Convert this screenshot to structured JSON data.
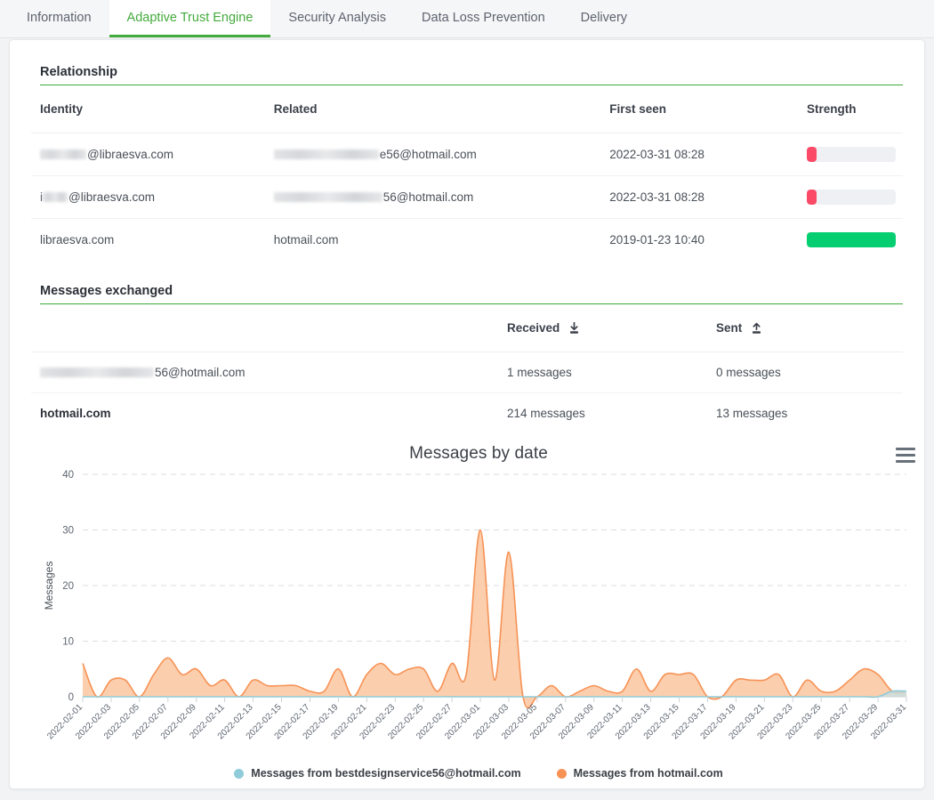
{
  "tabs": [
    {
      "label": "Information",
      "active": false
    },
    {
      "label": "Adaptive Trust Engine",
      "active": true
    },
    {
      "label": "Security Analysis",
      "active": false
    },
    {
      "label": "Data Loss Prevention",
      "active": false
    },
    {
      "label": "Delivery",
      "active": false
    }
  ],
  "relationship": {
    "title": "Relationship",
    "headers": [
      "Identity",
      "Related",
      "First seen",
      "Strength"
    ],
    "rows": [
      {
        "identity_masked_width": 52,
        "identity_suffix": "@libraesva.com",
        "related_masked_width": 118,
        "related_suffix": "e56@hotmail.com",
        "first_seen": "2022-03-31 08:28",
        "strength_percent": 11,
        "strength_color": "#fa4a68"
      },
      {
        "identity_masked_prefix": "i",
        "identity_masked_width": 28,
        "identity_suffix": "@libraesva.com",
        "related_masked_width": 122,
        "related_suffix": "56@hotmail.com",
        "first_seen": "2022-03-31 08:28",
        "strength_percent": 11,
        "strength_color": "#fa4a68"
      },
      {
        "identity_plain": "libraesva.com",
        "related_plain": "hotmail.com",
        "first_seen": "2019-01-23 10:40",
        "strength_percent": 100,
        "strength_color": "#05ce71"
      }
    ]
  },
  "messages_exchanged": {
    "title": "Messages exchanged",
    "headers": [
      "",
      "Received",
      "Sent"
    ],
    "received_icon": "download-icon",
    "sent_icon": "upload-icon",
    "rows": [
      {
        "address_masked_width": 128,
        "address_suffix": "56@hotmail.com",
        "received": "1 messages",
        "sent": "0 messages"
      },
      {
        "address_plain": "hotmail.com",
        "received": "214 messages",
        "sent": "13 messages"
      }
    ]
  },
  "chart_menu_icon": "hamburger-menu-icon",
  "chart_data": {
    "type": "area",
    "title": "Messages by date",
    "xlabel": "",
    "ylabel": "Messages",
    "ylim": [
      0,
      40
    ],
    "yticks": [
      0,
      10,
      20,
      30,
      40
    ],
    "grid": true,
    "legend_position": "bottom",
    "x": [
      "2022-02-01",
      "2022-02-02",
      "2022-02-03",
      "2022-02-04",
      "2022-02-05",
      "2022-02-06",
      "2022-02-07",
      "2022-02-08",
      "2022-02-09",
      "2022-02-10",
      "2022-02-11",
      "2022-02-12",
      "2022-02-13",
      "2022-02-14",
      "2022-02-15",
      "2022-02-16",
      "2022-02-17",
      "2022-02-18",
      "2022-02-19",
      "2022-02-20",
      "2022-02-21",
      "2022-02-22",
      "2022-02-23",
      "2022-02-24",
      "2022-02-25",
      "2022-02-26",
      "2022-02-27",
      "2022-02-28",
      "2022-03-01",
      "2022-03-02",
      "2022-03-03",
      "2022-03-04",
      "2022-03-05",
      "2022-03-06",
      "2022-03-07",
      "2022-03-08",
      "2022-03-09",
      "2022-03-10",
      "2022-03-11",
      "2022-03-12",
      "2022-03-13",
      "2022-03-14",
      "2022-03-15",
      "2022-03-16",
      "2022-03-17",
      "2022-03-18",
      "2022-03-19",
      "2022-03-20",
      "2022-03-21",
      "2022-03-22",
      "2022-03-23",
      "2022-03-24",
      "2022-03-25",
      "2022-03-26",
      "2022-03-27",
      "2022-03-28",
      "2022-03-29",
      "2022-03-30",
      "2022-03-31"
    ],
    "xtick_labels": [
      "2022-02-01",
      "2022-02-03",
      "2022-02-05",
      "2022-02-07",
      "2022-02-09",
      "2022-02-11",
      "2022-02-13",
      "2022-02-15",
      "2022-02-17",
      "2022-02-19",
      "2022-02-21",
      "2022-02-23",
      "2022-02-25",
      "2022-02-27",
      "2022-03-01",
      "2022-03-03",
      "2022-03-05",
      "2022-03-07",
      "2022-03-09",
      "2022-03-11",
      "2022-03-13",
      "2022-03-15",
      "2022-03-17",
      "2022-03-19",
      "2022-03-21",
      "2022-03-23",
      "2022-03-25",
      "2022-03-27",
      "2022-03-29",
      "2022-03-31"
    ],
    "series": [
      {
        "name": "Messages from bestdesignservice56@hotmail.com",
        "color": "#8fcbd9",
        "fill": "#c3dfe6",
        "values": [
          0,
          0,
          0,
          0,
          0,
          0,
          0,
          0,
          0,
          0,
          0,
          0,
          0,
          0,
          0,
          0,
          0,
          0,
          0,
          0,
          0,
          0,
          0,
          0,
          0,
          0,
          0,
          0,
          0,
          0,
          0,
          0,
          0,
          0,
          0,
          0,
          0,
          0,
          0,
          0,
          0,
          0,
          0,
          0,
          0,
          0,
          0,
          0,
          0,
          0,
          0,
          0,
          0,
          0,
          0,
          0,
          0,
          1,
          1
        ]
      },
      {
        "name": "Messages from hotmail.com",
        "color": "#f79255",
        "fill": "#fac69f",
        "values": [
          6,
          0,
          3,
          3,
          0,
          4,
          7,
          4,
          5,
          2,
          3,
          0,
          3,
          2,
          2,
          2,
          1,
          1,
          5,
          0,
          4,
          6,
          4,
          5,
          5,
          1,
          6,
          4,
          30,
          3,
          26,
          0,
          0,
          2,
          0,
          1,
          2,
          1,
          1,
          5,
          1,
          4,
          4,
          4,
          0,
          0,
          3,
          3,
          3,
          4,
          0,
          3,
          1,
          1,
          3,
          5,
          4,
          1,
          1
        ]
      }
    ],
    "legend": [
      {
        "label": "Messages from bestdesignservice56@hotmail.com",
        "color": "#8fcbd9"
      },
      {
        "label": "Messages from hotmail.com",
        "color": "#f79255"
      }
    ]
  }
}
